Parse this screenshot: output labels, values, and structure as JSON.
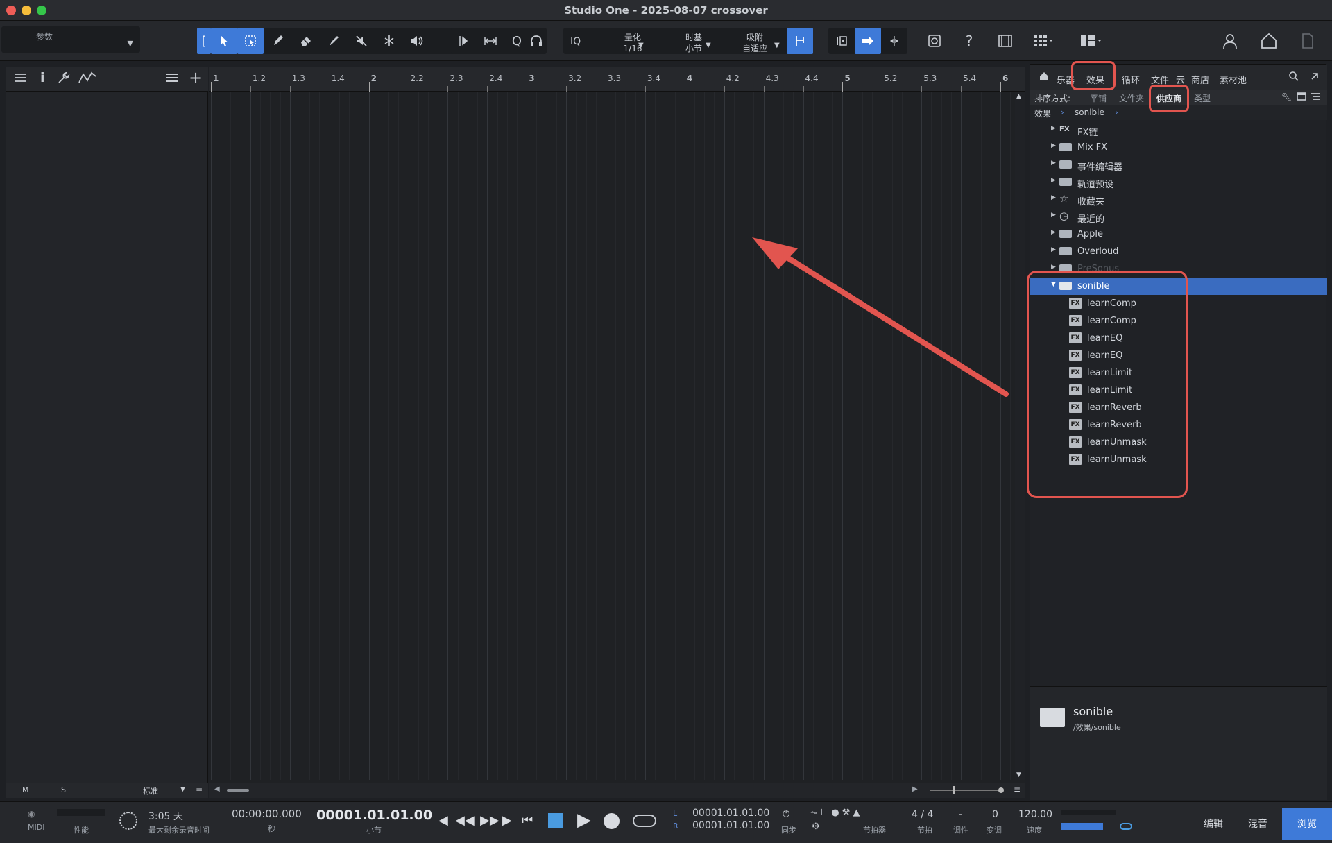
{
  "window": {
    "title": "Studio One - 2025-08-07 crossover",
    "colors": {
      "close": "#ee5d57",
      "minimize": "#f5bd3b",
      "zoom": "#35c64a",
      "accent": "#3e7ad8",
      "annotation": "#e2554f"
    }
  },
  "toolbar": {
    "param_label": "参数",
    "iq_label": "IQ",
    "quantize": {
      "label": "量化",
      "value": "1/16"
    },
    "timebase": {
      "label": "时基",
      "value": "小节"
    },
    "snap": {
      "label": "吸附",
      "value": "自适应"
    },
    "help_label": "?"
  },
  "left_footer": {
    "m": "M",
    "s": "S",
    "mode": "标准"
  },
  "ruler": {
    "ticks": [
      "1",
      "1.2",
      "1.3",
      "1.4",
      "2",
      "2.2",
      "2.3",
      "2.4",
      "3",
      "3.2",
      "3.3",
      "3.4",
      "4",
      "4.2",
      "4.3",
      "4.4",
      "5",
      "5.2",
      "5.3",
      "5.4",
      "6"
    ]
  },
  "browser": {
    "tabs": [
      "乐器",
      "效果",
      "循环",
      "文件",
      "云",
      "商店",
      "素材池"
    ],
    "sort_label": "排序方式:",
    "sort_options": [
      "平铺",
      "文件夹",
      "供应商",
      "类型"
    ],
    "crumbs": [
      "效果",
      "sonible"
    ],
    "tree": [
      {
        "label": "FX链",
        "icon": "fx-chain-icon",
        "type": "category"
      },
      {
        "label": "Mix FX",
        "icon": "folder-icon",
        "type": "category"
      },
      {
        "label": "事件编辑器",
        "icon": "folder-icon",
        "type": "category"
      },
      {
        "label": "轨道预设",
        "icon": "folder-icon",
        "type": "category"
      },
      {
        "label": "收藏夹",
        "icon": "star-icon",
        "type": "category"
      },
      {
        "label": "最近的",
        "icon": "clock-icon",
        "type": "category"
      },
      {
        "label": "Apple",
        "icon": "folder-icon",
        "type": "category"
      },
      {
        "label": "Overloud",
        "icon": "folder-icon",
        "type": "category"
      },
      {
        "label": "PreSonus",
        "icon": "folder-icon",
        "type": "category"
      },
      {
        "label": "sonible",
        "icon": "folder-open-icon",
        "type": "vendor",
        "selected": true
      },
      {
        "label": "learnComp",
        "icon": "fx-plugin-icon",
        "type": "plugin"
      },
      {
        "label": "learnComp",
        "icon": "fx-plugin-icon",
        "type": "plugin"
      },
      {
        "label": "learnEQ",
        "icon": "fx-plugin-icon",
        "type": "plugin"
      },
      {
        "label": "learnEQ",
        "icon": "fx-plugin-icon",
        "type": "plugin"
      },
      {
        "label": "learnLimit",
        "icon": "fx-plugin-icon",
        "type": "plugin"
      },
      {
        "label": "learnLimit",
        "icon": "fx-plugin-icon",
        "type": "plugin"
      },
      {
        "label": "learnReverb",
        "icon": "fx-plugin-icon",
        "type": "plugin"
      },
      {
        "label": "learnReverb",
        "icon": "fx-plugin-icon",
        "type": "plugin"
      },
      {
        "label": "learnUnmask",
        "icon": "fx-plugin-icon",
        "type": "plugin"
      },
      {
        "label": "learnUnmask",
        "icon": "fx-plugin-icon",
        "type": "plugin"
      }
    ],
    "info": {
      "name": "sonible",
      "path": "/效果/sonible"
    }
  },
  "transport": {
    "midi_label": "MIDI",
    "perf_label": "性能",
    "record_time": "3:05 天",
    "record_time_label": "最大剩余录音时间",
    "seconds_value": "00:00:00.000",
    "seconds_label": "秒",
    "bars_value": "00001.01.01.00",
    "bars_label": "小节",
    "loop_l_label": "L",
    "loop_r_label": "R",
    "loop_l": "00001.01.01.00",
    "loop_r": "00001.01.01.00",
    "sync_label": "同步",
    "metronome_label": "节拍器",
    "signature": "4 / 4",
    "signature_label": "节拍",
    "key": "-",
    "key_label": "调性",
    "transpose": "0",
    "transpose_label": "变调",
    "tempo": "120.00",
    "tempo_label": "速度",
    "pages": [
      "编辑",
      "混音",
      "浏览"
    ]
  }
}
